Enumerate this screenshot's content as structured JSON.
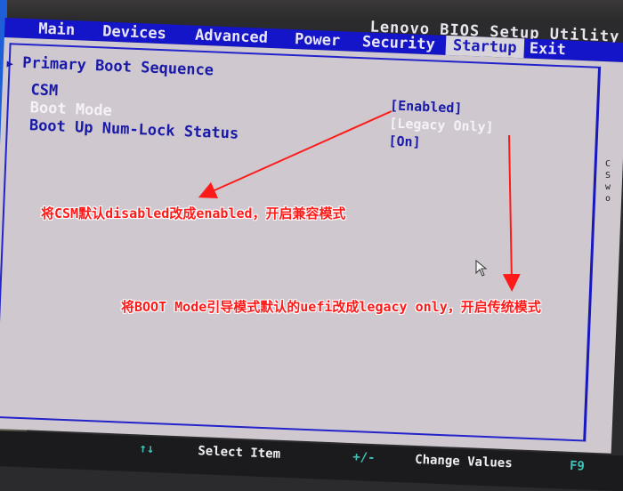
{
  "window": {
    "title": "Lenovo BIOS Setup Utility"
  },
  "menu": {
    "tabs": [
      {
        "label": "Main",
        "active": false
      },
      {
        "label": "Devices",
        "active": false
      },
      {
        "label": "Advanced",
        "active": false
      },
      {
        "label": "Power",
        "active": false
      },
      {
        "label": "Security",
        "active": false
      },
      {
        "label": "Startup",
        "active": true
      },
      {
        "label": "Exit",
        "active": false
      }
    ]
  },
  "startup": {
    "submenu": {
      "icon": "triangle-right-icon",
      "label": "Primary Boot Sequence"
    },
    "settings": [
      {
        "label": "CSM",
        "value": "[Enabled]",
        "selected": false
      },
      {
        "label": "Boot Mode",
        "value": "[Legacy Only]",
        "selected": true
      },
      {
        "label": "Boot Up Num-Lock Status",
        "value": "[On]",
        "selected": false
      }
    ]
  },
  "footer": {
    "items": [
      {
        "key": "↑↓",
        "label": "Select Item"
      },
      {
        "key": "+/-",
        "label": "Change Values"
      },
      {
        "key": "F9",
        "label": ""
      }
    ]
  },
  "annotations": [
    {
      "text": "将CSM默认disabled改成enabled，开启兼容模式",
      "color": "#ff1a1a"
    },
    {
      "text": "将BOOT Mode引导模式默认的uefi改成legacy only，开启传统模式",
      "color": "#ff1a1a"
    }
  ],
  "colors": {
    "menubar": "#1414c8",
    "panel": "#cfc9cf",
    "text": "#1a1aa8",
    "selected_text": "#f4f2f6",
    "footer_key": "#3ec2b8",
    "annotation": "#ff1a1a"
  }
}
